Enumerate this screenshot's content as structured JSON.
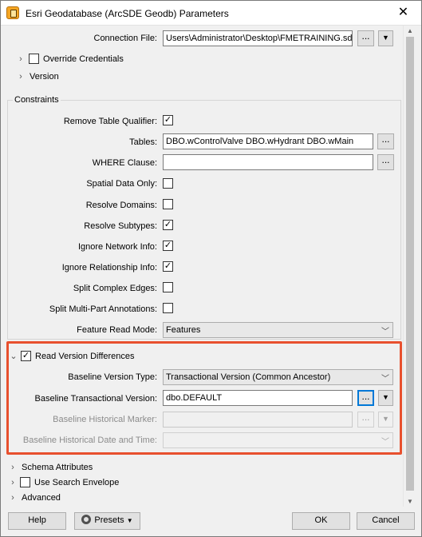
{
  "window": {
    "title": "Esri Geodatabase (ArcSDE Geodb) Parameters",
    "close_glyph": "✕"
  },
  "connection": {
    "file_label": "Connection File:",
    "file_value": "Users\\Administrator\\Desktop\\FMETRAINING.sde",
    "override_label": "Override Credentials",
    "version_label": "Version"
  },
  "constraints": {
    "title": "Constraints",
    "remove_qualifier_label": "Remove Table Qualifier:",
    "remove_qualifier_checked": true,
    "tables_label": "Tables:",
    "tables_value": "DBO.wControlValve DBO.wHydrant DBO.wMain",
    "where_label": "WHERE Clause:",
    "where_value": "",
    "spatial_only_label": "Spatial Data Only:",
    "spatial_only_checked": false,
    "resolve_domains_label": "Resolve Domains:",
    "resolve_domains_checked": false,
    "resolve_subtypes_label": "Resolve Subtypes:",
    "resolve_subtypes_checked": true,
    "ignore_network_label": "Ignore Network Info:",
    "ignore_network_checked": true,
    "ignore_relationship_label": "Ignore Relationship Info:",
    "ignore_relationship_checked": true,
    "split_edges_label": "Split Complex Edges:",
    "split_edges_checked": false,
    "split_annotations_label": "Split Multi-Part Annotations:",
    "split_annotations_checked": false,
    "read_mode_label": "Feature Read Mode:",
    "read_mode_value": "Features"
  },
  "version_diff": {
    "label": "Read Version Differences",
    "checked": true,
    "baseline_type_label": "Baseline Version Type:",
    "baseline_type_value": "Transactional Version (Common Ancestor)",
    "baseline_transactional_label": "Baseline Transactional Version:",
    "baseline_transactional_value": "dbo.DEFAULT",
    "baseline_marker_label": "Baseline Historical Marker:",
    "baseline_marker_value": "",
    "baseline_datetime_label": "Baseline Historical Date and Time:",
    "baseline_datetime_value": ""
  },
  "sections": {
    "schema_attributes": "Schema Attributes",
    "search_envelope": "Use Search Envelope",
    "advanced": "Advanced"
  },
  "buttons": {
    "help": "Help",
    "presets": "Presets",
    "ok": "OK",
    "cancel": "Cancel",
    "dots": "...",
    "dropdown": "▼"
  },
  "colors": {
    "highlight": "#e8502e",
    "focus": "#0078d7"
  }
}
